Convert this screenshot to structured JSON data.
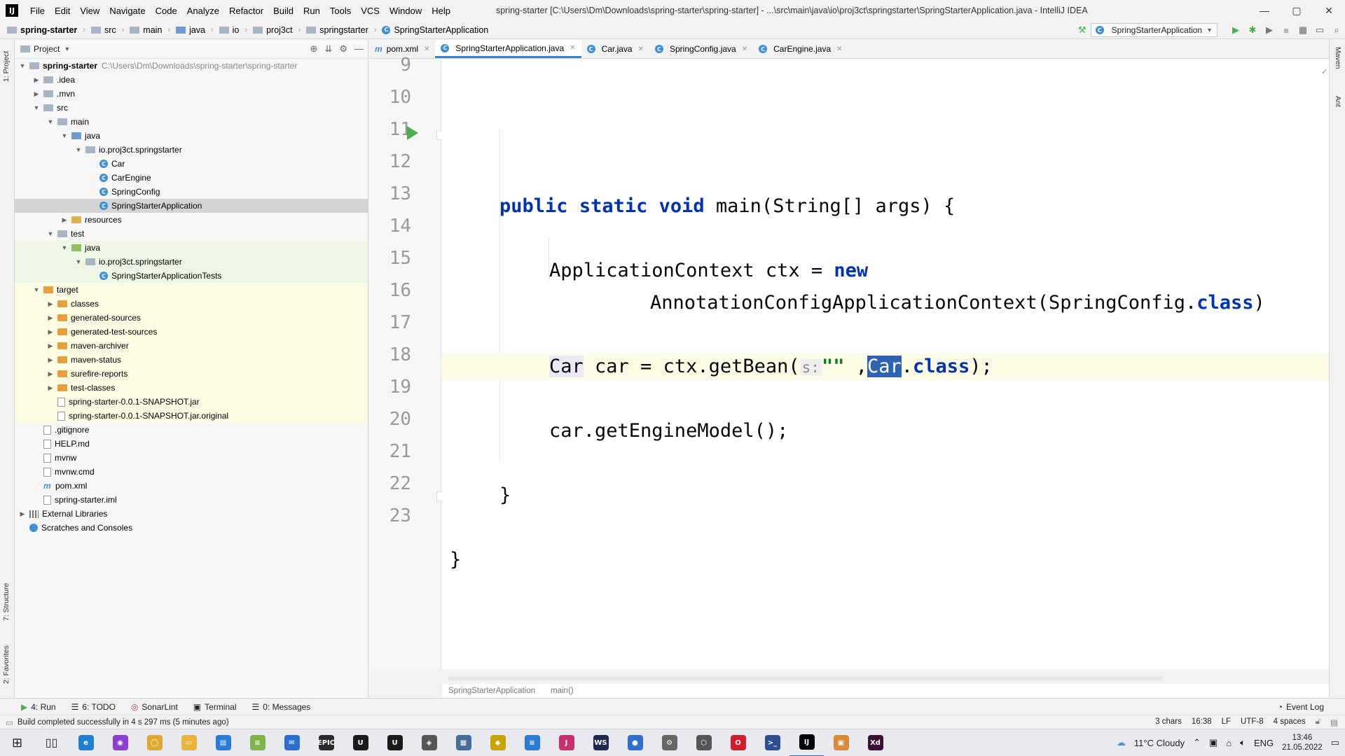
{
  "app": {
    "menu": [
      "File",
      "Edit",
      "View",
      "Navigate",
      "Code",
      "Analyze",
      "Refactor",
      "Build",
      "Run",
      "Tools",
      "VCS",
      "Window",
      "Help"
    ],
    "window_title": "spring-starter [C:\\Users\\Dm\\Downloads\\spring-starter\\spring-starter] - ...\\src\\main\\java\\io\\proj3ct\\springstarter\\SpringStarterApplication.java - IntelliJ IDEA"
  },
  "navbar": {
    "crumbs": [
      "spring-starter",
      "src",
      "main",
      "java",
      "io",
      "proj3ct",
      "springstarter",
      "SpringStarterApplication"
    ],
    "run_config": "SpringStarterApplication"
  },
  "strips": {
    "left_top": "1: Project",
    "left_mid": "7: Structure",
    "left_bottom": "2: Favorites",
    "right_top": "Maven",
    "right_mid": "Ant"
  },
  "project": {
    "header": "Project",
    "tree": [
      {
        "label": "spring-starter",
        "path": "C:\\Users\\Dm\\Downloads\\spring-starter\\spring-starter",
        "depth": 0,
        "arrow": "down",
        "icon": "folder",
        "bold": true
      },
      {
        "label": ".idea",
        "depth": 1,
        "arrow": "right",
        "icon": "folder"
      },
      {
        "label": ".mvn",
        "depth": 1,
        "arrow": "right",
        "icon": "folder"
      },
      {
        "label": "src",
        "depth": 1,
        "arrow": "down",
        "icon": "folder"
      },
      {
        "label": "main",
        "depth": 2,
        "arrow": "down",
        "icon": "folder"
      },
      {
        "label": "java",
        "depth": 3,
        "arrow": "down",
        "icon": "folder-blue"
      },
      {
        "label": "io.proj3ct.springstarter",
        "depth": 4,
        "arrow": "down",
        "icon": "folder"
      },
      {
        "label": "Car",
        "depth": 5,
        "arrow": "",
        "icon": "class"
      },
      {
        "label": "CarEngine",
        "depth": 5,
        "arrow": "",
        "icon": "class"
      },
      {
        "label": "SpringConfig",
        "depth": 5,
        "arrow": "",
        "icon": "class"
      },
      {
        "label": "SpringStarterApplication",
        "depth": 5,
        "arrow": "",
        "icon": "class",
        "state": "selected"
      },
      {
        "label": "resources",
        "depth": 3,
        "arrow": "right",
        "icon": "folder-yellow"
      },
      {
        "label": "test",
        "depth": 2,
        "arrow": "down",
        "icon": "folder"
      },
      {
        "label": "java",
        "depth": 3,
        "arrow": "down",
        "icon": "folder-green",
        "state": "green"
      },
      {
        "label": "io.proj3ct.springstarter",
        "depth": 4,
        "arrow": "down",
        "icon": "folder",
        "state": "green"
      },
      {
        "label": "SpringStarterApplicationTests",
        "depth": 5,
        "arrow": "",
        "icon": "class",
        "state": "green"
      },
      {
        "label": "target",
        "depth": 1,
        "arrow": "down",
        "icon": "folder-orange",
        "state": "yellow"
      },
      {
        "label": "classes",
        "depth": 2,
        "arrow": "right",
        "icon": "folder-orange",
        "state": "yellow"
      },
      {
        "label": "generated-sources",
        "depth": 2,
        "arrow": "right",
        "icon": "folder-orange",
        "state": "yellow"
      },
      {
        "label": "generated-test-sources",
        "depth": 2,
        "arrow": "right",
        "icon": "folder-orange",
        "state": "yellow"
      },
      {
        "label": "maven-archiver",
        "depth": 2,
        "arrow": "right",
        "icon": "folder-orange",
        "state": "yellow"
      },
      {
        "label": "maven-status",
        "depth": 2,
        "arrow": "right",
        "icon": "folder-orange",
        "state": "yellow"
      },
      {
        "label": "surefire-reports",
        "depth": 2,
        "arrow": "right",
        "icon": "folder-orange",
        "state": "yellow"
      },
      {
        "label": "test-classes",
        "depth": 2,
        "arrow": "right",
        "icon": "folder-orange",
        "state": "yellow"
      },
      {
        "label": "spring-starter-0.0.1-SNAPSHOT.jar",
        "depth": 2,
        "arrow": "",
        "icon": "file",
        "state": "yellow"
      },
      {
        "label": "spring-starter-0.0.1-SNAPSHOT.jar.original",
        "depth": 2,
        "arrow": "",
        "icon": "file",
        "state": "yellow"
      },
      {
        "label": ".gitignore",
        "depth": 1,
        "arrow": "",
        "icon": "file"
      },
      {
        "label": "HELP.md",
        "depth": 1,
        "arrow": "",
        "icon": "file"
      },
      {
        "label": "mvnw",
        "depth": 1,
        "arrow": "",
        "icon": "file"
      },
      {
        "label": "mvnw.cmd",
        "depth": 1,
        "arrow": "",
        "icon": "file"
      },
      {
        "label": "pom.xml",
        "depth": 1,
        "arrow": "",
        "icon": "maven"
      },
      {
        "label": "spring-starter.iml",
        "depth": 1,
        "arrow": "",
        "icon": "file"
      },
      {
        "label": "External Libraries",
        "depth": 0,
        "arrow": "right",
        "icon": "library"
      },
      {
        "label": "Scratches and Consoles",
        "depth": 0,
        "arrow": "",
        "icon": "scratch"
      }
    ]
  },
  "editor": {
    "tabs": [
      {
        "label": "pom.xml",
        "icon": "maven",
        "active": false
      },
      {
        "label": "SpringStarterApplication.java",
        "icon": "class",
        "active": true
      },
      {
        "label": "Car.java",
        "icon": "class",
        "active": false
      },
      {
        "label": "SpringConfig.java",
        "icon": "class",
        "active": false
      },
      {
        "label": "CarEngine.java",
        "icon": "class",
        "active": false
      }
    ],
    "line_numbers": [
      "9",
      "10",
      "11",
      "12",
      "13",
      "14",
      "15",
      "16",
      "17",
      "18",
      "19",
      "20",
      "21",
      "22",
      "23"
    ],
    "code": {
      "l11_kw1": "public",
      "l11_kw2": "static",
      "l11_kw3": "void",
      "l11_rest": " main(String[] args) {",
      "l13_a": "ApplicationContext ctx = ",
      "l13_kw": "new",
      "l14_a": "AnnotationConfigApplicationContext(SpringConfig.",
      "l14_kw": "class",
      "l14_b": ")",
      "l16_car": "Car",
      "l16_a": " car = ctx.getBean(",
      "l16_hint": "s:",
      "l16_str": "\"\"",
      "l16_b": " ,",
      "l16_sel": "Car",
      "l16_c": ".",
      "l16_kw": "class",
      "l16_d": ");",
      "l18": "car.getEngineModel();",
      "l20": "}",
      "l22": "}"
    },
    "breadcrumb": [
      "SpringStarterApplication",
      "main()"
    ]
  },
  "bottom_tools": [
    {
      "label": "4: Run",
      "icon": "play-icon"
    },
    {
      "label": "6: TODO",
      "icon": "list-icon"
    },
    {
      "label": "SonarLint",
      "icon": "sonarlint-icon"
    },
    {
      "label": "Terminal",
      "icon": "terminal-icon"
    },
    {
      "label": "0: Messages",
      "icon": "messages-icon"
    }
  ],
  "event_log": "Event Log",
  "status": {
    "message": "Build completed successfully in 4 s 297 ms (5 minutes ago)",
    "selection": "3 chars",
    "position": "16:38",
    "line_sep": "LF",
    "encoding": "UTF-8",
    "indent": "4 spaces"
  },
  "taskbar": {
    "weather": "11°C  Cloudy",
    "lang": "ENG",
    "time": "13:46",
    "date": "21.05.2022",
    "apps": [
      {
        "name": "edge",
        "color": "#1f7fd4",
        "glyph": "e"
      },
      {
        "name": "podcast",
        "color": "#8a3fd1",
        "glyph": "◉"
      },
      {
        "name": "chrome",
        "color": "#e0a82e",
        "glyph": "◯"
      },
      {
        "name": "explorer",
        "color": "#e7b53a",
        "glyph": "▭"
      },
      {
        "name": "store",
        "color": "#2d7ad6",
        "glyph": "▤"
      },
      {
        "name": "notepad",
        "color": "#7fb44a",
        "glyph": "≡"
      },
      {
        "name": "mail",
        "color": "#2a6ed0",
        "glyph": "✉"
      },
      {
        "name": "epic",
        "color": "#2b2b2b",
        "glyph": "EPIC"
      },
      {
        "name": "unreal",
        "color": "#1a1a1a",
        "glyph": "U"
      },
      {
        "name": "unreal2",
        "color": "#1a1a1a",
        "glyph": "U"
      },
      {
        "name": "unity",
        "color": "#555",
        "glyph": "◈"
      },
      {
        "name": "files",
        "color": "#4a6a9a",
        "glyph": "▦"
      },
      {
        "name": "app-yellow",
        "color": "#c8a400",
        "glyph": "◆"
      },
      {
        "name": "app-blue",
        "color": "#2b7bd6",
        "glyph": "≋"
      },
      {
        "name": "jetbrains",
        "color": "#c92f6e",
        "glyph": "J"
      },
      {
        "name": "webstorm",
        "color": "#1e2a50",
        "glyph": "WS"
      },
      {
        "name": "signal",
        "color": "#2f6fd0",
        "glyph": "●"
      },
      {
        "name": "settings",
        "color": "#666",
        "glyph": "⚙"
      },
      {
        "name": "cube",
        "color": "#555",
        "glyph": "⬡"
      },
      {
        "name": "opera",
        "color": "#d01f2a",
        "glyph": "O"
      },
      {
        "name": "powershell",
        "color": "#2c4f8f",
        "glyph": ">_"
      },
      {
        "name": "intellij",
        "color": "#000",
        "glyph": "IJ"
      },
      {
        "name": "box-app",
        "color": "#d98a36",
        "glyph": "▣"
      },
      {
        "name": "xd",
        "color": "#3d0f35",
        "glyph": "Xd"
      }
    ]
  }
}
